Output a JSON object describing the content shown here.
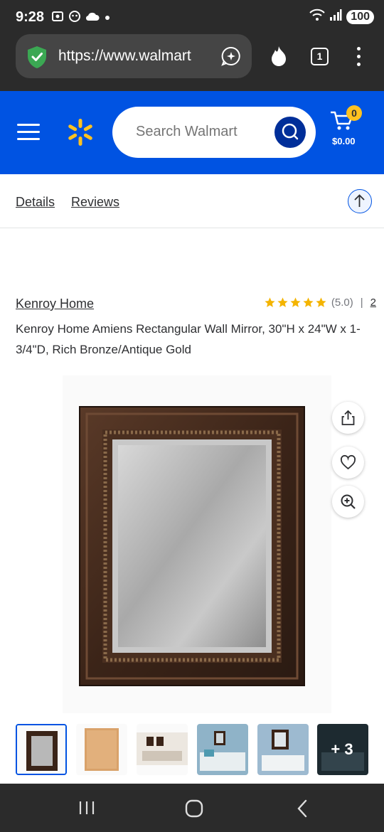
{
  "status": {
    "time": "9:28",
    "battery": "100"
  },
  "browser": {
    "url": "https://www.walmart",
    "tab_count": "1"
  },
  "header": {
    "search_placeholder": "Search Walmart",
    "cart_count": "0",
    "cart_total": "$0.00"
  },
  "subnav": {
    "details": "Details",
    "reviews": "Reviews"
  },
  "product": {
    "brand": "Kenroy Home",
    "rating_value": "(5.0)",
    "rating_sep": "|",
    "review_count": "2",
    "stars": 5,
    "title": "Kenroy Home Amiens Rectangular Wall Mirror, 30\"H x 24\"W x 1-3/4\"D, Rich Bronze/Antique Gold"
  },
  "thumbnails": {
    "more_label": "+ 3"
  },
  "colors": {
    "brand_blue": "#0053e2",
    "spark_yellow": "#ffc220",
    "star": "#f4b400"
  }
}
